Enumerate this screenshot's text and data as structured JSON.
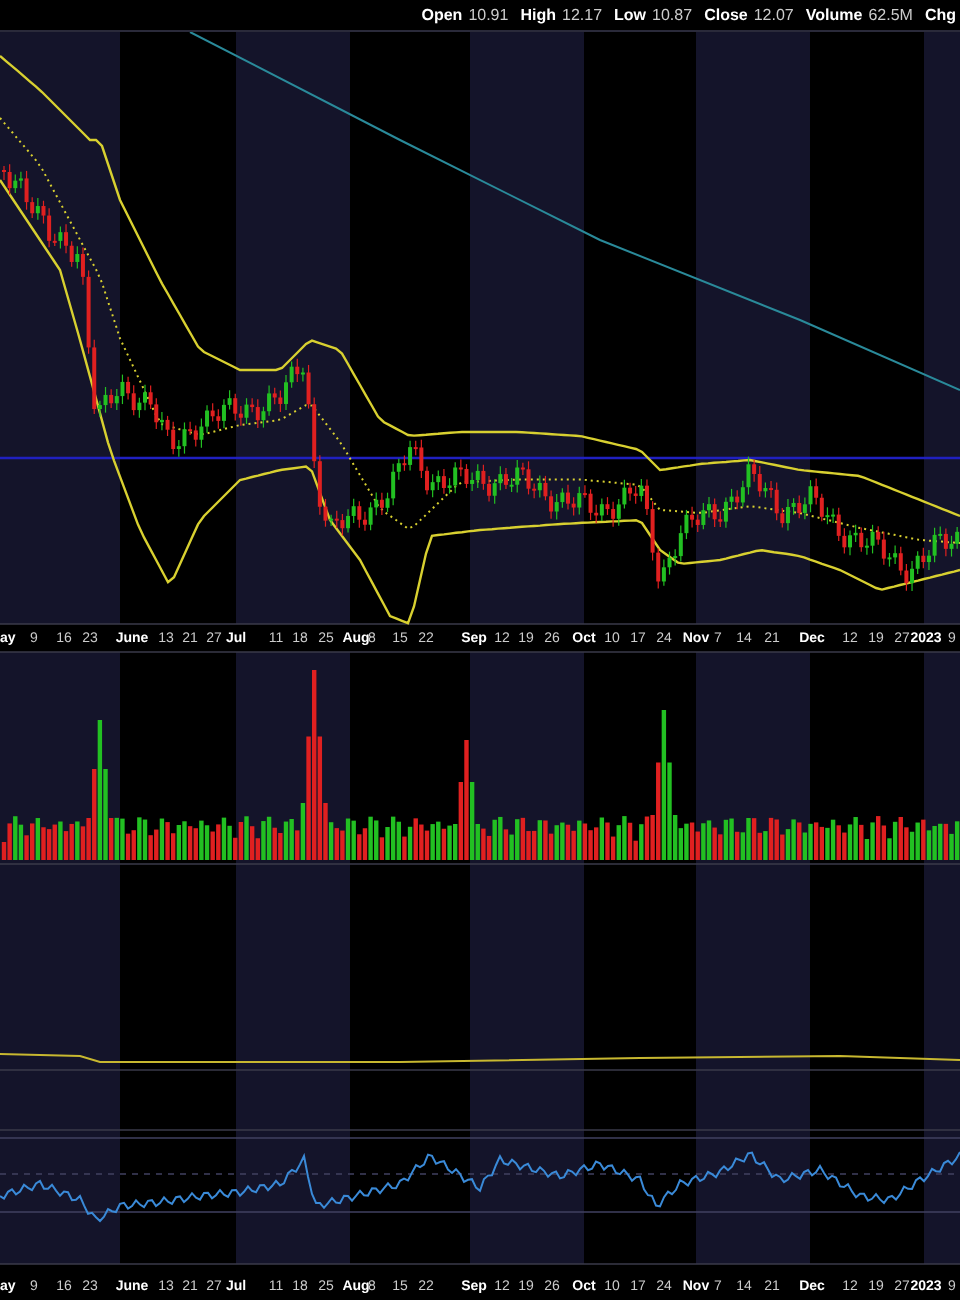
{
  "quote": [
    {
      "label": "Open",
      "value": "10.91"
    },
    {
      "label": "High",
      "value": "12.17"
    },
    {
      "label": "Low",
      "value": "10.87"
    },
    {
      "label": "Close",
      "value": "12.07"
    },
    {
      "label": "Volume",
      "value": "62.5M"
    },
    {
      "label": "Chg"
    }
  ],
  "price_axis": {
    "labels": [
      "ay",
      "9",
      "16",
      "23",
      "June",
      "13",
      "21",
      "27",
      "Jul",
      "11",
      "18",
      "25",
      "Aug",
      "8",
      "15",
      "22",
      "Sep",
      "12",
      "19",
      "26",
      "Oct",
      "10",
      "17",
      "24",
      "Nov",
      "7",
      "14",
      "21",
      "Dec",
      "12",
      "19",
      "27",
      "2023",
      "9"
    ]
  },
  "bottom_axis": {
    "labels": [
      "ay",
      "9",
      "16",
      "23",
      "June",
      "13",
      "21",
      "27",
      "Jul",
      "11",
      "18",
      "25",
      "Aug",
      "8",
      "15",
      "22",
      "Sep",
      "12",
      "19",
      "26",
      "Oct",
      "10",
      "17",
      "24",
      "Nov",
      "7",
      "14",
      "21",
      "Dec",
      "12",
      "19",
      "27",
      "2023",
      "9"
    ]
  }
}
